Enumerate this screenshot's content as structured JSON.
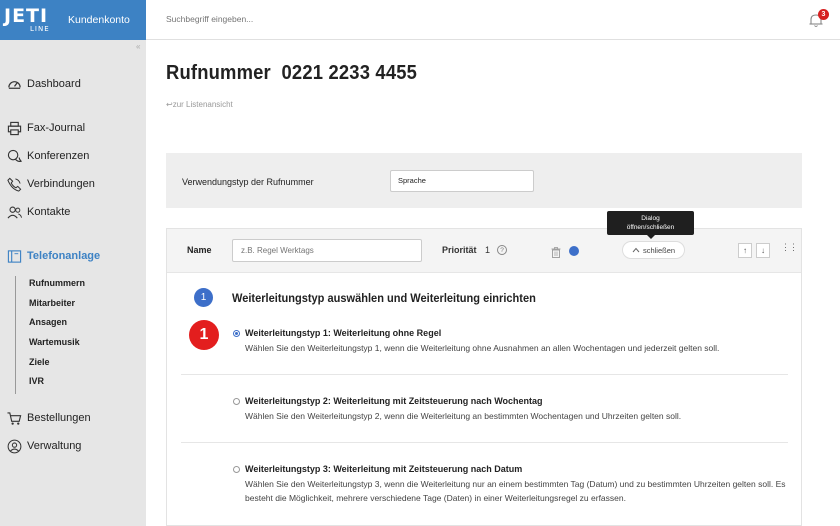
{
  "brand": {
    "logo_main": "JETI",
    "logo_sub": "LINE",
    "account_label": "Kundenkonto",
    "primary_color": "#3d82c4"
  },
  "search": {
    "placeholder": "Suchbegriff eingeben..."
  },
  "notifications": {
    "count": "3"
  },
  "sidebar": {
    "items": [
      {
        "label": "Dashboard",
        "icon": "dashboard-icon"
      },
      {
        "label": "Fax-Journal",
        "icon": "printer-icon"
      },
      {
        "label": "Konferenzen",
        "icon": "chat-icon"
      },
      {
        "label": "Verbindungen",
        "icon": "phone-icon"
      },
      {
        "label": "Kontakte",
        "icon": "contacts-icon"
      },
      {
        "label": "Telefonanlage",
        "icon": "phone-system-icon",
        "active": true
      },
      {
        "label": "Bestellungen",
        "icon": "cart-icon"
      },
      {
        "label": "Verwaltung",
        "icon": "user-icon"
      }
    ],
    "subitems": [
      "Rufnummern",
      "Mitarbeiter",
      "Ansagen",
      "Wartemusik",
      "Ziele",
      "IVR"
    ]
  },
  "page": {
    "title": "Rufnummer  0221 2233 4455",
    "back_link": "zur Listenansicht",
    "usage_label": "Verwendungstyp der Rufnummer",
    "usage_value": "Sprache"
  },
  "tooltip": {
    "line1": "Dialog",
    "line2": "öffnen/schließen"
  },
  "rule": {
    "name_label": "Name",
    "name_placeholder": "z.B. Regel Werktags",
    "priority_label": "Priorität",
    "priority_value": "1",
    "help_symbol": "?",
    "close_label": "schließen",
    "step_number": "1",
    "step_title": "Weiterleitungstyp auswählen und Weiterleitung einrichten",
    "highlight_badge": "1",
    "options": [
      {
        "title": "Weiterleitungstyp 1: Weiterleitung ohne Regel",
        "desc": "Wählen Sie den Weiterleitungstyp 1, wenn die Weiterleitung ohne Ausnahmen an allen Wochentagen und jederzeit gelten soll.",
        "selected": true
      },
      {
        "title": "Weiterleitungstyp 2: Weiterleitung mit Zeitsteuerung nach Wochentag",
        "desc": "Wählen Sie den Weiterleitungstyp 2, wenn die Weiterleitung an bestimmten Wochentagen und Uhrzeiten gelten soll.",
        "selected": false
      },
      {
        "title": "Weiterleitungstyp 3: Weiterleitung mit Zeitsteuerung nach Datum",
        "desc": "Wählen Sie den Weiterleitungstyp 3, wenn die Weiterleitung nur an einem bestimmten Tag (Datum) und zu bestimmten Uhrzeiten gelten soll. Es besteht die Möglichkeit, mehrere verschiedene Tage (Daten) in einer Weiterleitungsregel zu erfassen.",
        "selected": false
      }
    ]
  }
}
